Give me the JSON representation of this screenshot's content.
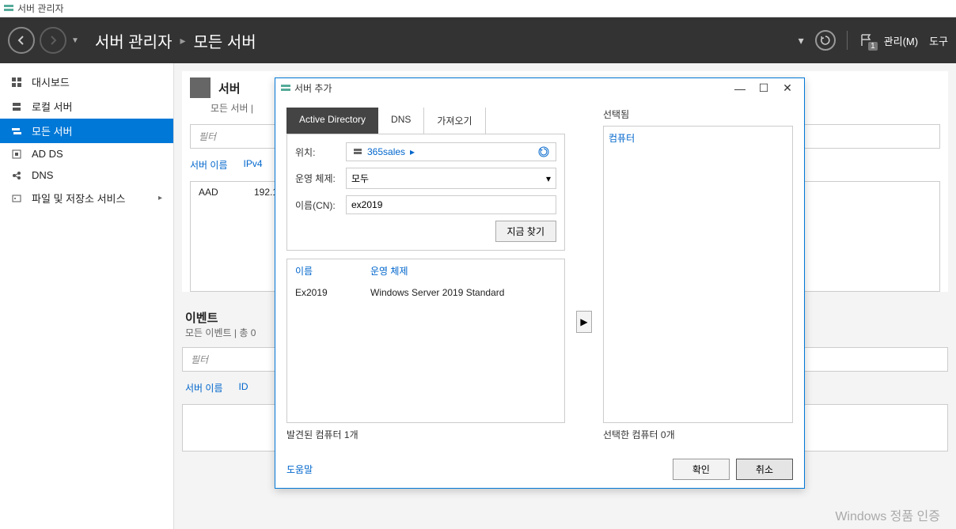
{
  "app_title": "서버 관리자",
  "breadcrumb": {
    "root": "서버 관리자",
    "current": "모든 서버"
  },
  "header_menu": {
    "manage": "관리(M)",
    "tools": "도구"
  },
  "flag_count": "1",
  "sidebar": {
    "items": [
      {
        "label": "대시보드"
      },
      {
        "label": "로컬 서버"
      },
      {
        "label": "모든 서버"
      },
      {
        "label": "AD DS"
      },
      {
        "label": "DNS"
      },
      {
        "label": "파일 및 저장소 서비스"
      }
    ]
  },
  "panel_servers": {
    "title": "서버",
    "subtitle": "모든 서버 |",
    "filter_placeholder": "필터",
    "col1": "서버 이름",
    "col2": "IPv4",
    "row_name": "AAD",
    "row_ip": "192.1"
  },
  "panel_events": {
    "title": "이벤트",
    "subtitle": "모든 이벤트 | 총 0",
    "filter_placeholder": "필터",
    "col1": "서버 이름",
    "col2": "ID"
  },
  "dialog": {
    "title": "서버 추가",
    "tabs": {
      "ad": "Active Directory",
      "dns": "DNS",
      "import": "가져오기"
    },
    "form": {
      "location_label": "위치:",
      "location_value": "365sales",
      "os_label": "운영 체제:",
      "os_value": "모두",
      "name_label": "이름(CN):",
      "name_value": "ex2019",
      "search_btn": "지금 찾기"
    },
    "results": {
      "col_name": "이름",
      "col_os": "운영 체제",
      "row_name": "Ex2019",
      "row_os": "Windows Server 2019 Standard"
    },
    "found_text": "발견된 컴퓨터 1개",
    "selected_label": "선택됨",
    "selected_header": "컴퓨터",
    "selected_count": "선택한 컴퓨터 0개",
    "help": "도움말",
    "ok": "확인",
    "cancel": "취소"
  },
  "watermark": "Windows 정품 인증"
}
